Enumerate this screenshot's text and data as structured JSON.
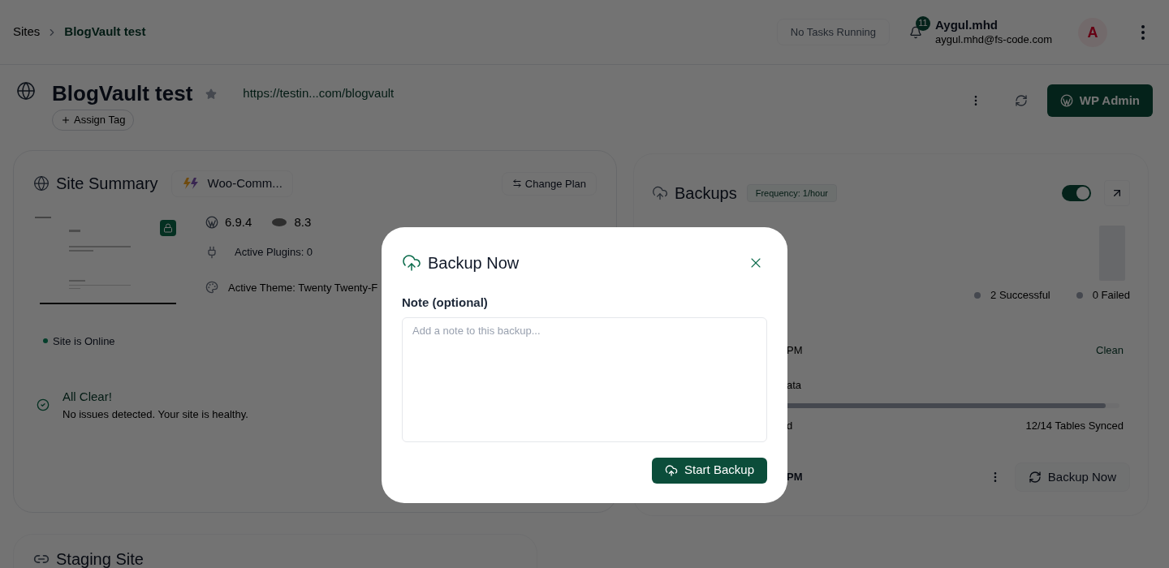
{
  "header": {
    "breadcrumb": [
      {
        "label": "Sites",
        "selected": false
      },
      {
        "label": "BlogVault test",
        "selected": true
      }
    ],
    "task_status": "No Tasks Running",
    "notifications": "11",
    "user": {
      "name": "Aygul.mhd",
      "email": "aygul.mhd@fs-code.com",
      "initial": "A"
    }
  },
  "site": {
    "title": "BlogVault test",
    "url": "https://testin...com/blogvault",
    "tag_button": "Assign Tag",
    "admin_button": "WP Admin"
  },
  "summary": {
    "title": "Site Summary",
    "plan": "Woo-Comm...",
    "change_plan": "Change Plan",
    "wp_version": "6.9.4",
    "php_version": "8.3",
    "plugins": "Active Plugins: 0",
    "theme": "Active Theme: Twenty Twenty-F",
    "status": {
      "label": "Site is Online",
      "online": true
    },
    "health": {
      "title": "All Clear!",
      "message": "No issues detected. Your site is healthy."
    }
  },
  "backups": {
    "title": "Backups",
    "frequency": "Frequency: 1/hour",
    "auto_backup": {
      "on": true
    },
    "legend": [
      "2 Successful",
      "0 Failed"
    ],
    "last_backup": {
      "time": "PM",
      "status": "Clean"
    },
    "sync": {
      "label": "ata",
      "level": 0.97,
      "left": "d",
      "right": "12/14 Tables Synced"
    },
    "next": {
      "time": "PM",
      "button": "Backup Now"
    }
  },
  "staging": {
    "title": "Staging Site"
  },
  "modal": {
    "title": "Backup Now",
    "note_label": "Note (optional)",
    "placeholder": "Add a note to this backup...",
    "submit": "Start Backup"
  }
}
